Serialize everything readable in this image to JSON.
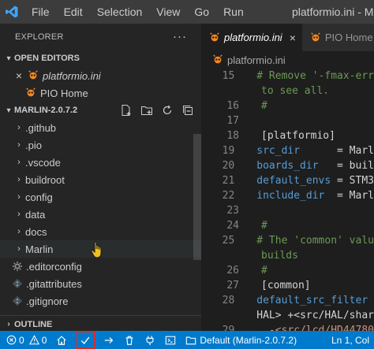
{
  "menu": {
    "items": [
      "File",
      "Edit",
      "Selection",
      "View",
      "Go",
      "Run"
    ],
    "window_title": "platformio.ini - Mar"
  },
  "sidebar": {
    "explorer_label": "EXPLORER",
    "more_actions": "···",
    "open_editors_label": "OPEN EDITORS",
    "open_editors": [
      {
        "label": "platformio.ini",
        "icon": "alien-icon",
        "close": "×"
      },
      {
        "label": "PIO Home",
        "icon": "alien-icon"
      }
    ],
    "project_label": "MARLIN-2.0.7.2",
    "folders": [
      ".github",
      ".pio",
      ".vscode",
      "buildroot",
      "config",
      "data",
      "docs",
      "Marlin"
    ],
    "files": [
      {
        "label": ".editorconfig",
        "icon": "gear-icon"
      },
      {
        "label": ".gitattributes",
        "icon": "git-icon"
      },
      {
        "label": ".gitignore",
        "icon": "git-icon"
      }
    ],
    "outline_label": "OUTLINE"
  },
  "tabs": [
    {
      "label": "platformio.ini",
      "close": "×"
    },
    {
      "label": "PIO Home"
    }
  ],
  "breadcrumb": {
    "label": "platformio.ini"
  },
  "code": {
    "lines": [
      {
        "n": "15",
        "text": "# Remove '-fmax-err",
        "kind": "comment"
      },
      {
        "n": "",
        "text": "to see all.",
        "kind": "comment"
      },
      {
        "n": "16",
        "text": "#",
        "kind": "comment"
      },
      {
        "n": "17",
        "text": "",
        "kind": "plain"
      },
      {
        "n": "18",
        "text": "[platformio]",
        "kind": "section"
      },
      {
        "n": "19",
        "key": "src_dir",
        "val": "      = Marl",
        "kind": "kv"
      },
      {
        "n": "20",
        "key": "boards_dir",
        "val": "   = buil",
        "kind": "kv"
      },
      {
        "n": "21",
        "key": "default_envs",
        "val": " = STM3",
        "kind": "kv"
      },
      {
        "n": "22",
        "key": "include_dir",
        "val": "  = Marl",
        "kind": "kv"
      },
      {
        "n": "23",
        "text": "",
        "kind": "plain"
      },
      {
        "n": "24",
        "text": "#",
        "kind": "comment"
      },
      {
        "n": "25",
        "text": "# The 'common' valu",
        "kind": "comment"
      },
      {
        "n": "",
        "text": "builds",
        "kind": "comment"
      },
      {
        "n": "26",
        "text": "#",
        "kind": "comment"
      },
      {
        "n": "27",
        "text": "[common]",
        "kind": "section"
      },
      {
        "n": "28",
        "key": "default_src_filter",
        "val": " ",
        "kind": "kv"
      },
      {
        "n": "",
        "text": "HAL> +<src/HAL/shar",
        "kind": "plain"
      },
      {
        "n": "29",
        "text": "  -<src/lcd/HD44780",
        "kind": "str"
      }
    ]
  },
  "statusbar": {
    "errors": "0",
    "warnings": "0",
    "env_label": "Default (Marlin-2.0.7.2)",
    "position": "Ln 1, Col"
  },
  "colors": {
    "accent": "#007acc",
    "pio_orange": "#f5871f",
    "highlight_box": "#d12e2e"
  }
}
